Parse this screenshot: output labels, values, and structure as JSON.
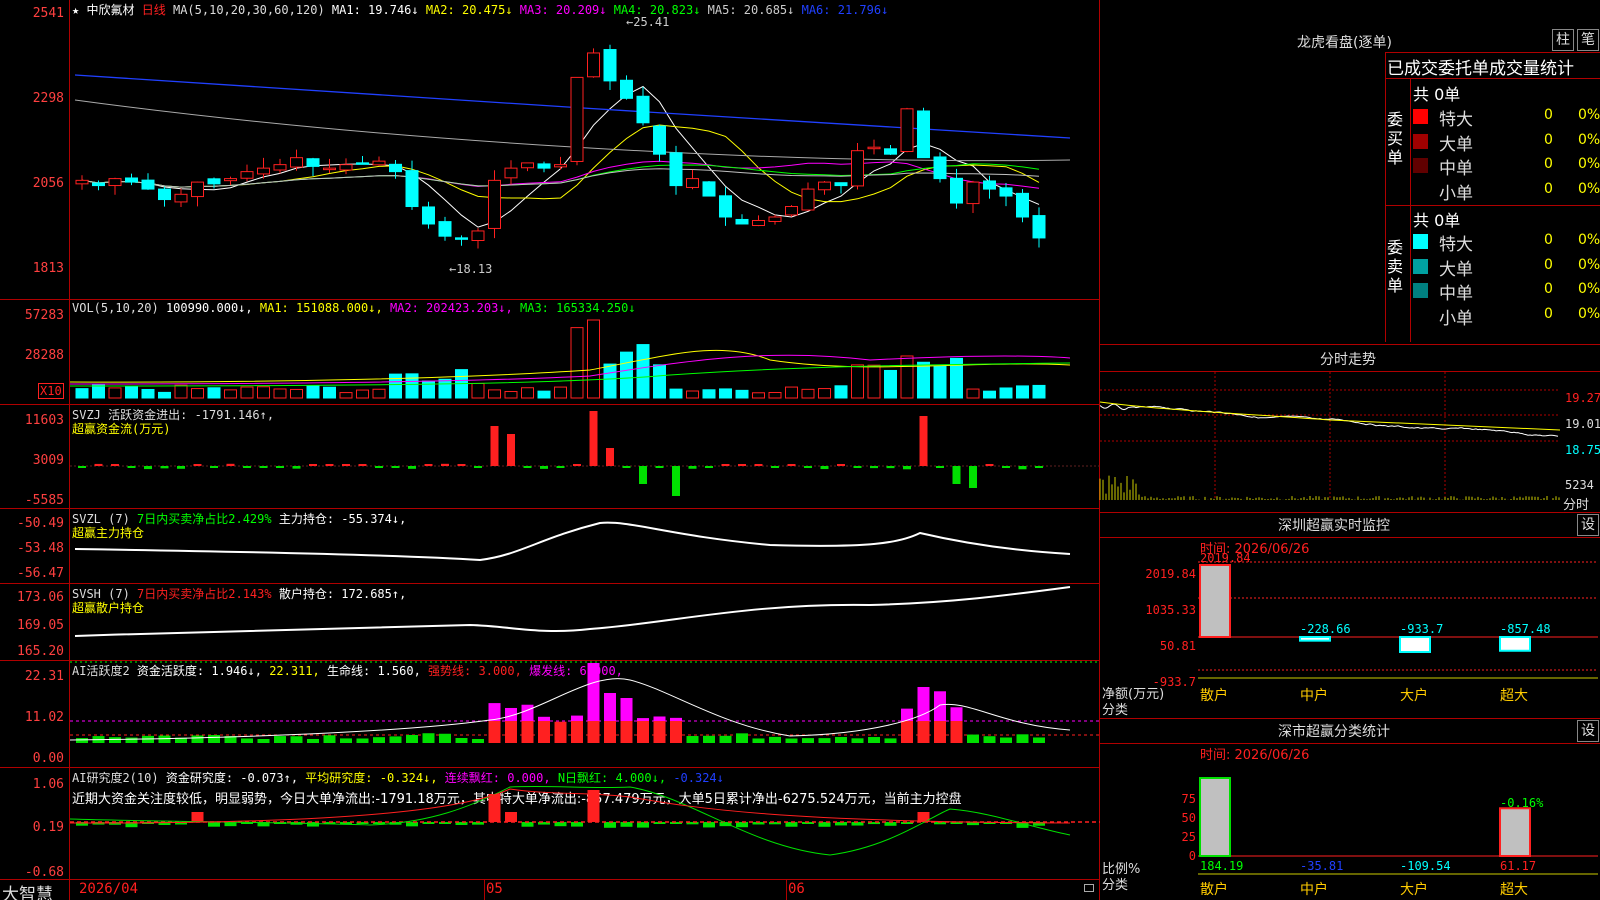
{
  "app": {
    "brand": "大智慧"
  },
  "main_chart": {
    "header": {
      "star": "★",
      "stock_name": "中欣氟材",
      "period": "日线",
      "ma_label": "MA(5,10,20,30,60,120)",
      "ma1": "MA1: 19.746↓",
      "ma2": "MA2: 20.475↓",
      "ma3": "MA3: 20.209↓",
      "ma4": "MA4: 20.823↓",
      "ma5": "MA5: 20.685↓",
      "ma6": "MA6: 21.796↓"
    },
    "y_labels": [
      "2541",
      "2298",
      "2056",
      "1813"
    ],
    "high_mark": "←25.41",
    "low_mark": "←18.13"
  },
  "vol": {
    "header_a": "VOL(5,10,20)",
    "header_b": "100990.000↓,",
    "ma1": "MA1: 151088.000↓,",
    "ma2": "MA2: 202423.203↓,",
    "ma3": "MA3: 165334.250↓",
    "y_labels": [
      "57283",
      "28288"
    ],
    "unit": "X10"
  },
  "svzj": {
    "header": "SVZJ  活跃资金进出: -1791.146↑,",
    "sub": "超赢资金流(万元)",
    "y_labels": [
      "11603",
      "3009",
      "-5585"
    ]
  },
  "svzl": {
    "header_a": "SVZL (7)",
    "header_b": "7日内买卖净占比2.429%",
    "header_c": "主力持仓: -55.374↓,",
    "sub": "超赢主力持仓",
    "y_labels": [
      "-50.49",
      "-53.48",
      "-56.47"
    ]
  },
  "svsh": {
    "header_a": "SVSH (7)",
    "header_b": "7日内买卖净占比2.143%",
    "header_c": "散户持仓: 172.685↑,",
    "sub": "超赢散户持仓",
    "y_labels": [
      "173.06",
      "169.05",
      "165.20"
    ]
  },
  "ai1": {
    "header_a": "AI活跃度2",
    "header_b": "资金活跃度: 1.946↓,",
    "header_c": "22.311,",
    "header_d": "生命线: 1.560,",
    "header_e": "强势线: 3.000,",
    "header_f": "爆发线: 6.000,",
    "y_labels": [
      "22.31",
      "11.02",
      "0.00"
    ]
  },
  "ai2": {
    "header_a": "AI研究度2(10)",
    "header_b": "资金研究度: -0.073↑,",
    "header_c": "平均研究度: -0.324↓,",
    "header_d": "连续飘红: 0.000,",
    "header_e": "N日飘红: 4.000↓,",
    "header_f": "-0.324↓",
    "comment": "近期大资金关注度较低，明显弱势，今日大单净流出:-1791.18万元，其中特大单净流出:-857.479万元，大单5日累计净出-6275.524万元，当前主力控盘",
    "y_labels": [
      "1.06",
      "0.19",
      "-0.68"
    ]
  },
  "x_axis": {
    "labels": [
      "2026/04",
      "05",
      "06"
    ]
  },
  "dragon": {
    "title": "龙虎看盘(逐单)",
    "btn_col": "柱",
    "btn_pen": "笔",
    "tabs": "已成交委托单成交量统计",
    "buy_side": "委买单",
    "sell_side": "委卖单",
    "buy_total": "共 0单",
    "sell_total": "共 0单",
    "buy_rows": [
      {
        "name": "特大",
        "count": "0",
        "pct": "0%",
        "color": "#ff0000"
      },
      {
        "name": "大单",
        "count": "0",
        "pct": "0%",
        "color": "#a00000"
      },
      {
        "name": "中单",
        "count": "0",
        "pct": "0%",
        "color": "#600000"
      },
      {
        "name": "小单",
        "count": "0",
        "pct": "0%",
        "color": "#000000"
      }
    ],
    "sell_rows": [
      {
        "name": "特大",
        "count": "0",
        "pct": "0%",
        "color": "#00ffff"
      },
      {
        "name": "大单",
        "count": "0",
        "pct": "0%",
        "color": "#00a0a0"
      },
      {
        "name": "中单",
        "count": "0",
        "pct": "0%",
        "color": "#008080"
      },
      {
        "name": "小单",
        "count": "0",
        "pct": "0%",
        "color": "#000000"
      }
    ]
  },
  "intraday": {
    "title": "分时走势",
    "price_labels": [
      "19.27",
      "19.01",
      "18.75"
    ],
    "vol_label": "5234",
    "vol_unit": "分时"
  },
  "sz_monitor": {
    "title": "深圳超赢实时监控",
    "btn": "设",
    "time": "时间: 2026/06/26",
    "y_labels": [
      "2019.84",
      "1035.33",
      "50.81",
      "-933.7"
    ],
    "y_title_a": "净额(万元)",
    "y_title_b": "分类",
    "values": [
      {
        "category": "散户",
        "value": 2019.84,
        "label": "2019.84"
      },
      {
        "category": "中户",
        "value": -228.66,
        "label": "-228.66"
      },
      {
        "category": "大户",
        "value": -933.7,
        "label": "-933.7"
      },
      {
        "category": "超大",
        "value": -857.48,
        "label": "-857.48"
      }
    ]
  },
  "sz_stats": {
    "title": "深市超赢分类统计",
    "btn": "设",
    "time": "时间: 2026/06/26",
    "y_labels": [
      "75",
      "50",
      "25",
      "0"
    ],
    "y_title_a": "比例%",
    "y_title_b": "分类",
    "pct_label": "-0.16%",
    "values": [
      {
        "category": "散户",
        "value": 184.19,
        "label": "184.19"
      },
      {
        "category": "中户",
        "value": -35.81,
        "label": "-35.81"
      },
      {
        "category": "大户",
        "value": -109.54,
        "label": "-109.54"
      },
      {
        "category": "超大",
        "value": 61.17,
        "label": "61.17"
      }
    ]
  },
  "colors": {
    "up": "#ff2020",
    "down": "#00ffff",
    "grid": "#b00000"
  }
}
